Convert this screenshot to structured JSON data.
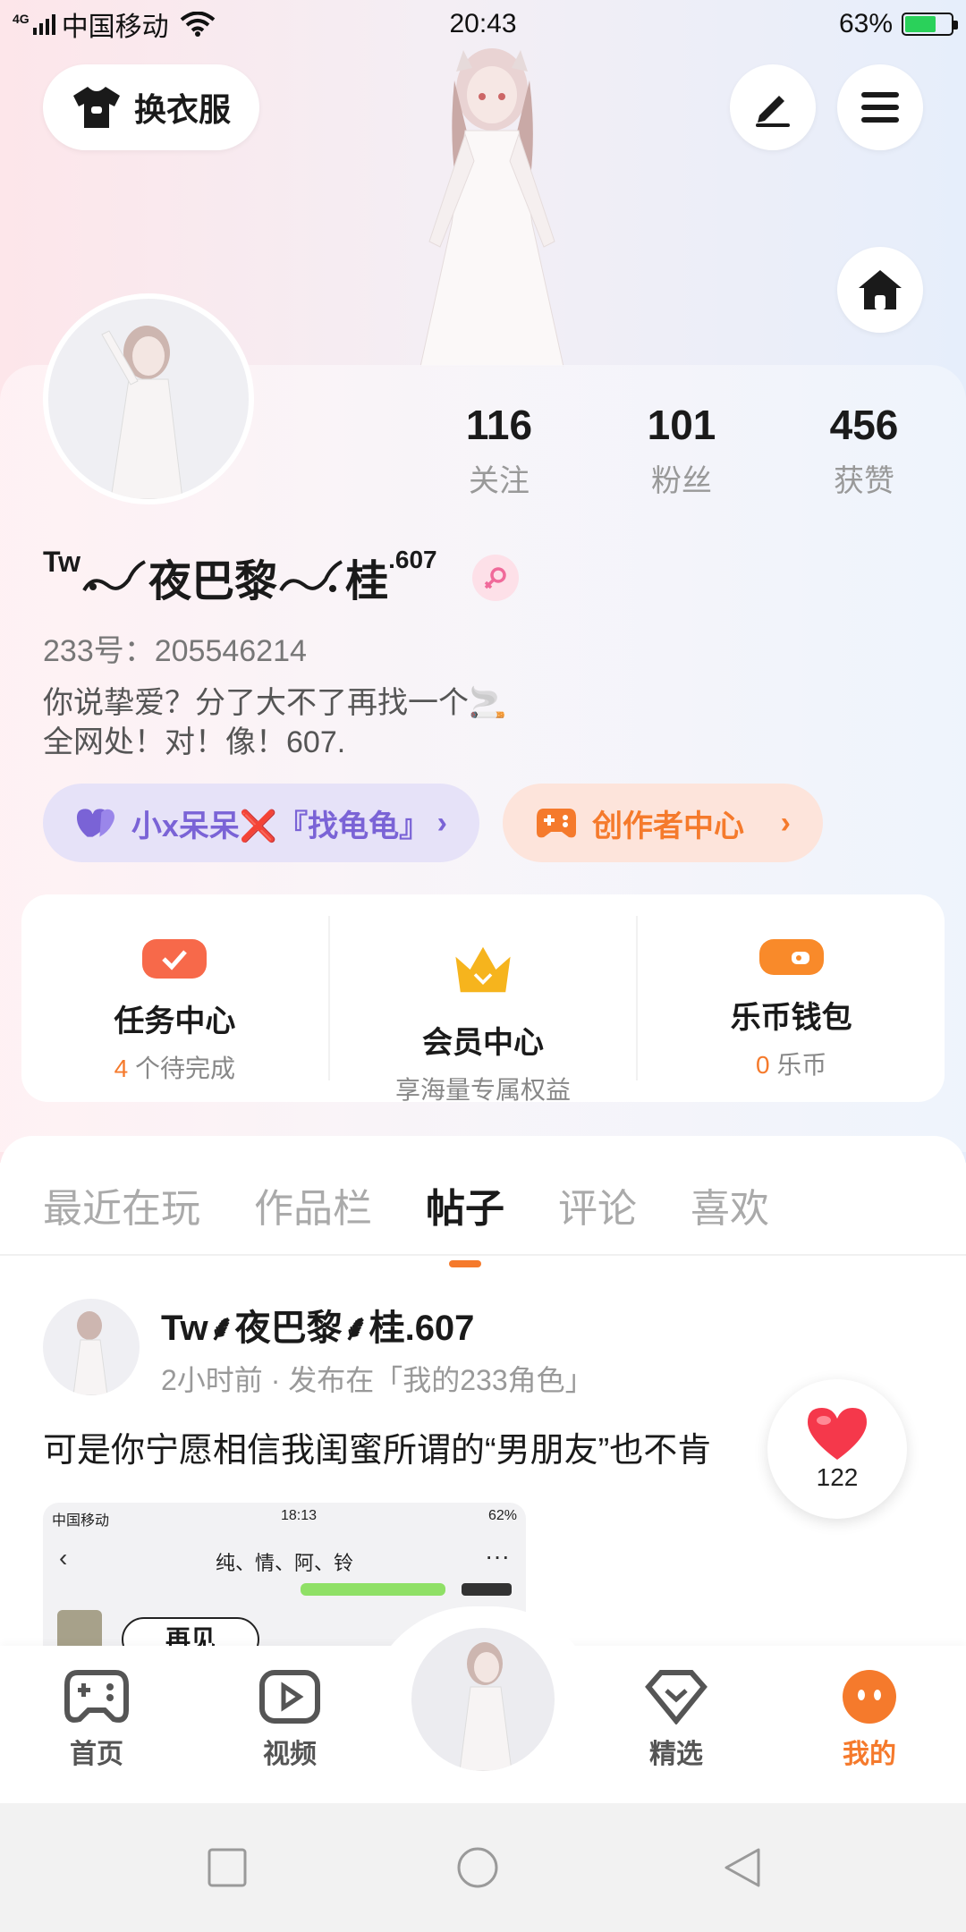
{
  "status_bar": {
    "network": "4G",
    "carrier": "中国移动",
    "time": "20:43",
    "battery_percent": "63%",
    "battery_level": 0.63
  },
  "header": {
    "dress_up_label": "换衣服",
    "edit_icon": "pen-icon",
    "menu_icon": "hamburger-menu-icon",
    "home_icon": "home-icon"
  },
  "profile": {
    "nickname_prefix": "Tw",
    "nickname_part1": "夜巴黎",
    "nickname_part2": "桂",
    "nickname_suffix": "607",
    "gender_icon": "female-icon",
    "uid": "233号：205546214",
    "bio_line1": "你说挚爱？分了大不了再找一个🚬",
    "bio_line2": "全网处！对！像！607.",
    "stats": [
      {
        "value": "116",
        "label": "关注"
      },
      {
        "value": "101",
        "label": "粉丝"
      },
      {
        "value": "456",
        "label": "获赞"
      }
    ],
    "group_pill": "小x呆呆❌『找龟龟』",
    "creator_pill": "创作者中心"
  },
  "features": [
    {
      "title": "任务中心",
      "count": "4",
      "sub": " 个待完成",
      "icon": "calendar-check-icon",
      "color": "#f7694a"
    },
    {
      "title": "会员中心",
      "count": "",
      "sub": "享海量专属权益",
      "icon": "crown-icon",
      "color": "#f6b41d"
    },
    {
      "title": "乐币钱包",
      "count": "0",
      "sub": " 乐币",
      "icon": "wallet-icon",
      "color": "#f98a2a"
    }
  ],
  "tabs": [
    "最近在玩",
    "作品栏",
    "帖子",
    "评论",
    "喜欢"
  ],
  "active_tab": "帖子",
  "post": {
    "author": "Tw⸙夜巴黎⸙桂.607",
    "time": "2小时前",
    "published_in": "发布在「我的233角色」",
    "text": "可是你宁愿相信我闺蜜所谓的“男朋友”也不肯",
    "likes": "122",
    "image": {
      "carrier": "中国移动",
      "time": "18:13",
      "battery": "62%",
      "title": "纯、情、阿、铃",
      "bubble": "再见"
    }
  },
  "bottom_nav": [
    {
      "label": "首页",
      "icon": "gamepad-icon"
    },
    {
      "label": "视频",
      "icon": "play-icon"
    },
    {
      "label": "精选",
      "icon": "heart-shield-icon"
    },
    {
      "label": "我的",
      "icon": "face-icon"
    }
  ],
  "colors": {
    "accent": "#f57a2c",
    "purple": "#7a63d6",
    "like_red": "#f5384b"
  }
}
